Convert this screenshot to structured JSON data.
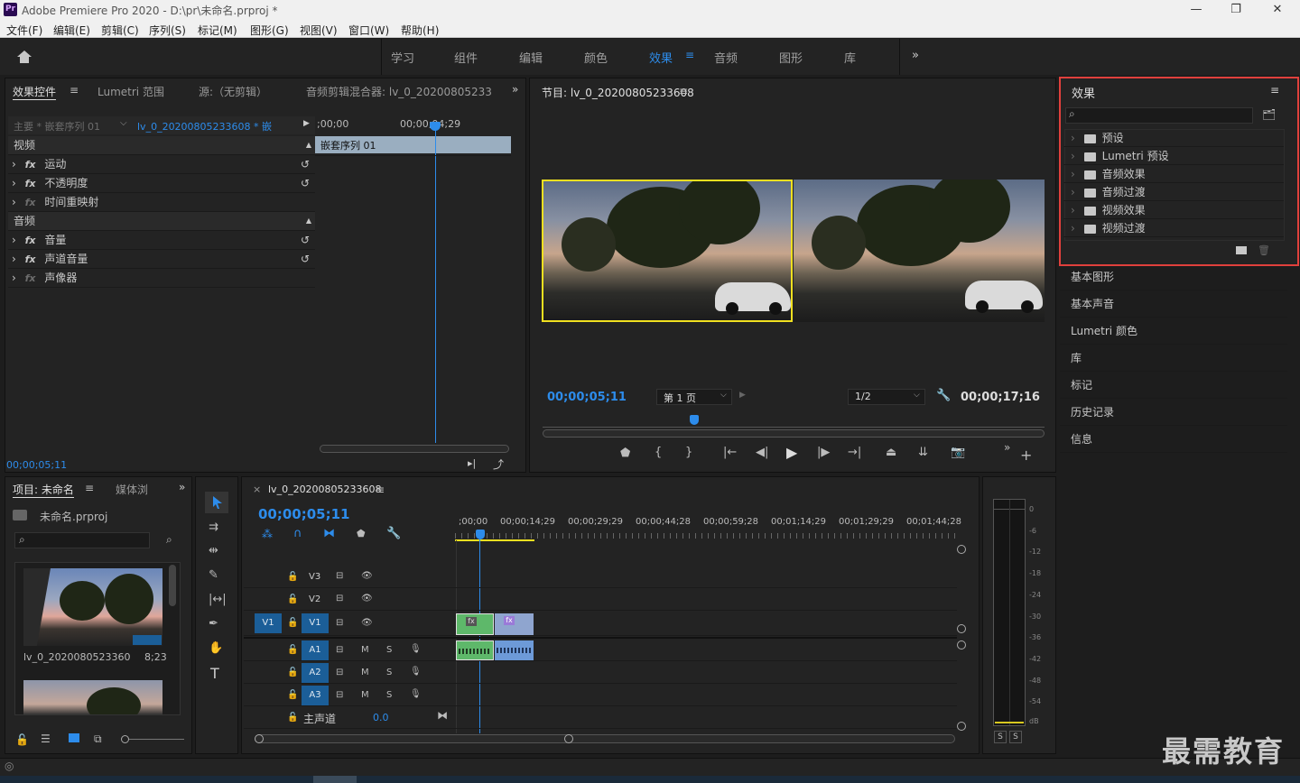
{
  "window": {
    "title": "Adobe Premiere Pro 2020 - D:\\pr\\未命名.prproj *",
    "logo": "Pr",
    "minimize": "—",
    "maximize": "❐",
    "close": "✕"
  },
  "menu": [
    "文件(F)",
    "编辑(E)",
    "剪辑(C)",
    "序列(S)",
    "标记(M)",
    "图形(G)",
    "视图(V)",
    "窗口(W)",
    "帮助(H)"
  ],
  "workspaces": {
    "items": [
      "学习",
      "组件",
      "编辑",
      "颜色",
      "效果",
      "音频",
      "图形",
      "库"
    ],
    "active": "效果",
    "more": "»"
  },
  "effect_controls": {
    "tabs": [
      "效果控件",
      "Lumetri 范围",
      "源:（无剪辑）",
      "音频剪辑混合器: lv_0_2020080523360"
    ],
    "master": "主要 * 嵌套序列 01",
    "clip": "lv_0_20200805233608 * 嵌...",
    "timecode_start": ";00;00",
    "timecode_mid": "00;00;04;29",
    "clip_bar": "嵌套序列 01",
    "section_video": "视频",
    "section_audio": "音频",
    "video_effects": [
      "运动",
      "不透明度",
      "时间重映射"
    ],
    "audio_effects": [
      "音量",
      "声道音量",
      "声像器"
    ],
    "fx": "fx",
    "footer_timecode": "00;00;05;11"
  },
  "program_monitor": {
    "title": "节目: lv_0_20200805233608",
    "timecode": "00;00;05;11",
    "page_select": "第 1 页",
    "zoom": "1/2",
    "duration": "00;00;17;16"
  },
  "project": {
    "tabs": [
      "项目: 未命名",
      "媒体浏"
    ],
    "file": "未命名.prproj",
    "item_name": "lv_0_20200805233608...",
    "item_duration": "8;23"
  },
  "timeline": {
    "tab": "lv_0_20200805233608",
    "timecode": "00;00;05;11",
    "ruler": [
      ";00;00",
      "00;00;14;29",
      "00;00;29;29",
      "00;00;44;28",
      "00;00;59;28",
      "00;01;14;29",
      "00;01;29;29",
      "00;01;44;28"
    ],
    "video_tracks": [
      "V3",
      "V2",
      "V1"
    ],
    "audio_tracks": [
      "A1",
      "A2",
      "A3"
    ],
    "source_v": "V1",
    "master": "主声道",
    "master_value": "0.0",
    "mute": "M",
    "solo": "S",
    "clip_fx": "fx"
  },
  "meters": {
    "scale": [
      "0",
      "-6",
      "-12",
      "-18",
      "-24",
      "-30",
      "-36",
      "-42",
      "-48",
      "-54",
      "dB"
    ],
    "solo": [
      "S",
      "S"
    ]
  },
  "effects_panel": {
    "title": "效果",
    "search_placeholder": "",
    "items": [
      "预设",
      "Lumetri 预设",
      "音频效果",
      "音频过渡",
      "视频效果",
      "视频过渡"
    ]
  },
  "right_panels": [
    "基本图形",
    "基本声音",
    "Lumetri 颜色",
    "库",
    "标记",
    "历史记录",
    "信息"
  ],
  "watermark": "最需教育",
  "colors": {
    "accent_blue": "#2d8ceb",
    "highlight_red": "#e0403c",
    "frame_yellow": "#f0e020"
  }
}
